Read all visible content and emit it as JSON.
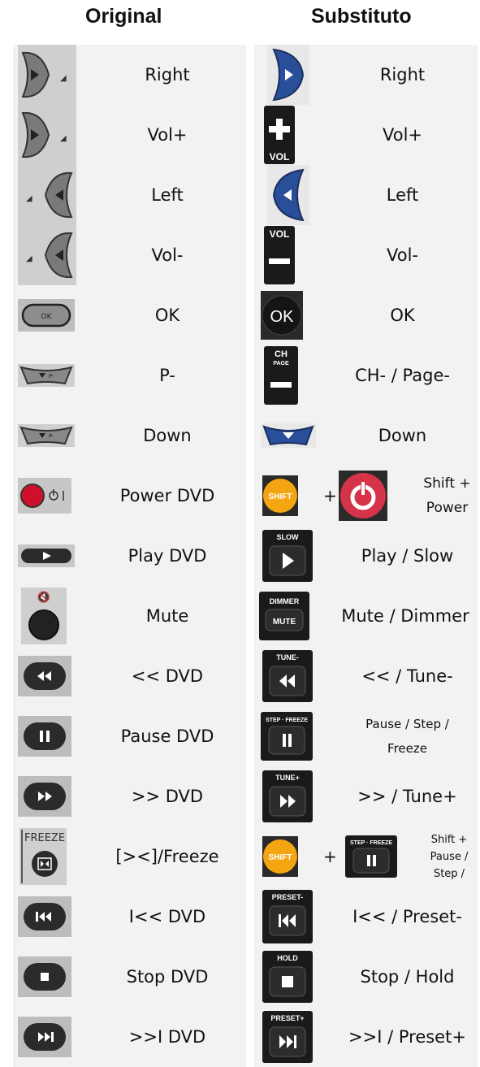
{
  "headers": {
    "original": "Original",
    "substitute": "Substituto"
  },
  "rows": [
    {
      "original": "Right",
      "substitute": "Right",
      "orig_icon": "right-arrow-button-icon",
      "sub_icon": "blue-right-arrow-button-icon"
    },
    {
      "original": "Vol+",
      "substitute": "Vol+",
      "orig_icon": "right-arrow-button-icon",
      "sub_icon": "vol-plus-button-icon"
    },
    {
      "original": "Left",
      "substitute": "Left",
      "orig_icon": "left-arrow-button-icon",
      "sub_icon": "blue-left-arrow-button-icon"
    },
    {
      "original": "Vol-",
      "substitute": "Vol-",
      "orig_icon": "left-arrow-button-icon",
      "sub_icon": "vol-minus-button-icon"
    },
    {
      "original": "OK",
      "substitute": "OK",
      "orig_icon": "ok-button-icon",
      "sub_icon": "ok-round-button-icon"
    },
    {
      "original": "P-",
      "substitute": "CH- / Page-",
      "orig_icon": "p-minus-button-icon",
      "sub_icon": "ch-page-minus-button-icon"
    },
    {
      "original": "Down",
      "substitute": "Down",
      "orig_icon": "p-minus-button-icon",
      "sub_icon": "blue-down-arrow-button-icon"
    },
    {
      "original": "Power DVD",
      "substitute": "Shift + Power",
      "orig_icon": "red-power-button-icon",
      "sub_icon": "shift-plus-power-button-icon",
      "sub_extra": {
        "shift": "SHIFT",
        "plus": "+",
        "line1": "Shift +",
        "line2": "Power"
      }
    },
    {
      "original": "Play DVD",
      "substitute": "Play / Slow",
      "orig_icon": "play-button-icon",
      "sub_icon": "play-slow-button-icon",
      "sub_caption": "SLOW"
    },
    {
      "original": "Mute",
      "substitute": "Mute / Dimmer",
      "orig_icon": "mute-button-icon",
      "sub_icon": "mute-dimmer-button-icon",
      "sub_caption": "DIMMER",
      "sub_inner": "MUTE"
    },
    {
      "original": "<< DVD",
      "substitute": "<< / Tune-",
      "orig_icon": "rewind-button-icon",
      "sub_icon": "rewind-tune-button-icon",
      "sub_caption": "TUNE-"
    },
    {
      "original": "Pause DVD",
      "substitute": "Pause / Step / Freeze",
      "orig_icon": "pause-button-icon",
      "sub_icon": "pause-step-freeze-button-icon",
      "sub_caption": "STEP · FREEZE",
      "sub_lines": [
        "Pause / Step /",
        "Freeze"
      ]
    },
    {
      "original": ">> DVD",
      "substitute": ">> / Tune+",
      "orig_icon": "fast-forward-button-icon",
      "sub_icon": "fast-forward-tune-button-icon",
      "sub_caption": "TUNE+"
    },
    {
      "original": "[><]/Freeze",
      "substitute": "Shift + Pause / Step /",
      "orig_icon": "freeze-button-icon",
      "orig_caption": "FREEZE",
      "sub_icon": "shift-plus-pause-button-icon",
      "sub_extra": {
        "shift": "SHIFT",
        "plus": "+",
        "caption": "STEP · FREEZE",
        "line1": "Shift +",
        "line2": "Pause /",
        "line3": "Step /"
      }
    },
    {
      "original": "I<< DVD",
      "substitute": "I<< / Preset-",
      "orig_icon": "skip-back-button-icon",
      "sub_icon": "skip-back-preset-button-icon",
      "sub_caption": "PRESET-"
    },
    {
      "original": "Stop DVD",
      "substitute": "Stop / Hold",
      "orig_icon": "stop-button-icon",
      "sub_icon": "stop-hold-button-icon",
      "sub_caption": "HOLD"
    },
    {
      "original": ">>I DVD",
      "substitute": ">>I / Preset+",
      "orig_icon": "skip-forward-button-icon",
      "sub_icon": "skip-forward-preset-button-icon",
      "sub_caption": "PRESET+"
    }
  ],
  "button_text": {
    "ok": "OK",
    "vol": "VOL",
    "ch": "CH",
    "page": "PAGE",
    "p_minus": "P-"
  },
  "colors": {
    "cell_bg": "#f2f2f2",
    "blue_button": "#2a4f9a",
    "shift_orange": "#f5a512",
    "power_red": "#d4334a",
    "orig_red": "#d0102a"
  }
}
